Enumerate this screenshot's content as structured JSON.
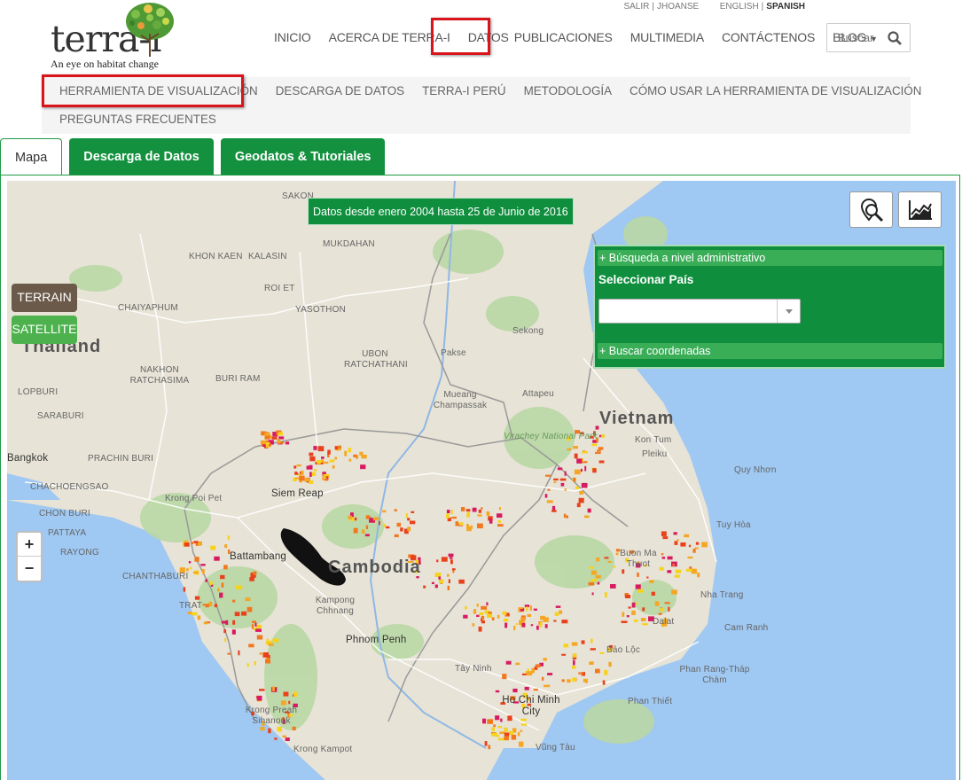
{
  "logo": {
    "brand": "terra-i",
    "tagline": "An eye on habitat change"
  },
  "topbar": {
    "logout": "SALIR",
    "user": "JHOANSE",
    "lang_en": "ENGLISH",
    "lang_es": "SPANISH"
  },
  "nav": {
    "items": [
      "INICIO",
      "ACERCA DE TERRA-I",
      "DATOS",
      "PUBLICACIONES",
      "MULTIMEDIA",
      "CONTÁCTENOS",
      "BLOG"
    ],
    "highlighted": "DATOS"
  },
  "search": {
    "placeholder": "Buscar"
  },
  "subnav": {
    "items": [
      "HERRAMIENTA DE VISUALIZACIÓN",
      "DESCARGA DE DATOS",
      "TERRA-I PERÚ",
      "METODOLOGÍA",
      "CÓMO USAR LA HERRAMIENTA DE VISUALIZACIÓN",
      "PREGUNTAS FRECUENTES"
    ],
    "highlighted": "HERRAMIENTA DE VISUALIZACIÓN"
  },
  "tabs": [
    "Mapa",
    "Descarga de Datos",
    "Geodatos & Tutoriales"
  ],
  "map": {
    "banner": "Datos desde enero 2004 hasta 25 de Junio de 2016",
    "terrain_label": "TERRAIN",
    "satellite_label": "SATELLITE",
    "zoom_in": "+",
    "zoom_out": "−",
    "panel": {
      "admin_search": "+ Búsqueda a nivel administrativo",
      "select_country": "Seleccionar País",
      "coord_search": "+ Buscar coordenadas",
      "country_value": ""
    },
    "labels": {
      "countries": [
        "Thailand",
        "Vietnam",
        "Cambodia"
      ],
      "cities": [
        "Bangkok",
        "Phnom Penh",
        "Ho Chi Minh City",
        "Siem Reap",
        "Battambang"
      ],
      "places": [
        "SAKON",
        "KHON KAEN",
        "KALASIN",
        "MUKDAHAN",
        "ROI ET",
        "YASOTHON",
        "CHAIYAPHUM",
        "UBON RATCHATHANI",
        "NAKHON RATCHASIMA",
        "BURI RAM",
        "LOPBURI",
        "SARABURI",
        "PRACHIN BURI",
        "CHACHOENGSAO",
        "CHON BURI",
        "PATTAYA",
        "RAYONG",
        "CHANTHABURI",
        "TRAT",
        "Pakse",
        "Mueang Champassak",
        "Attapeu",
        "Sekong",
        "Kon Tum",
        "Pleiku",
        "Quy Nhơn",
        "Tuy Hòa",
        "Buon Ma Thuot",
        "Nha Trang",
        "Dalat",
        "Cam Ranh",
        "Bảo Lộc",
        "Phan Rang-Tháp Chàm",
        "Phan Thiết",
        "Vũng Tàu",
        "Tây Ninh",
        "Kampong Chhnang",
        "Krong Preah Sihanouk",
        "Krong Kampot",
        "Krong Poi Pet",
        "Virachey National Park"
      ]
    }
  },
  "colors": {
    "brand_green": "#0f8f3e",
    "highlight_red": "#d9141a",
    "terrain_brown": "#6b5a49",
    "satellite_green": "#4db24e",
    "sea": "#9fc8f2"
  }
}
